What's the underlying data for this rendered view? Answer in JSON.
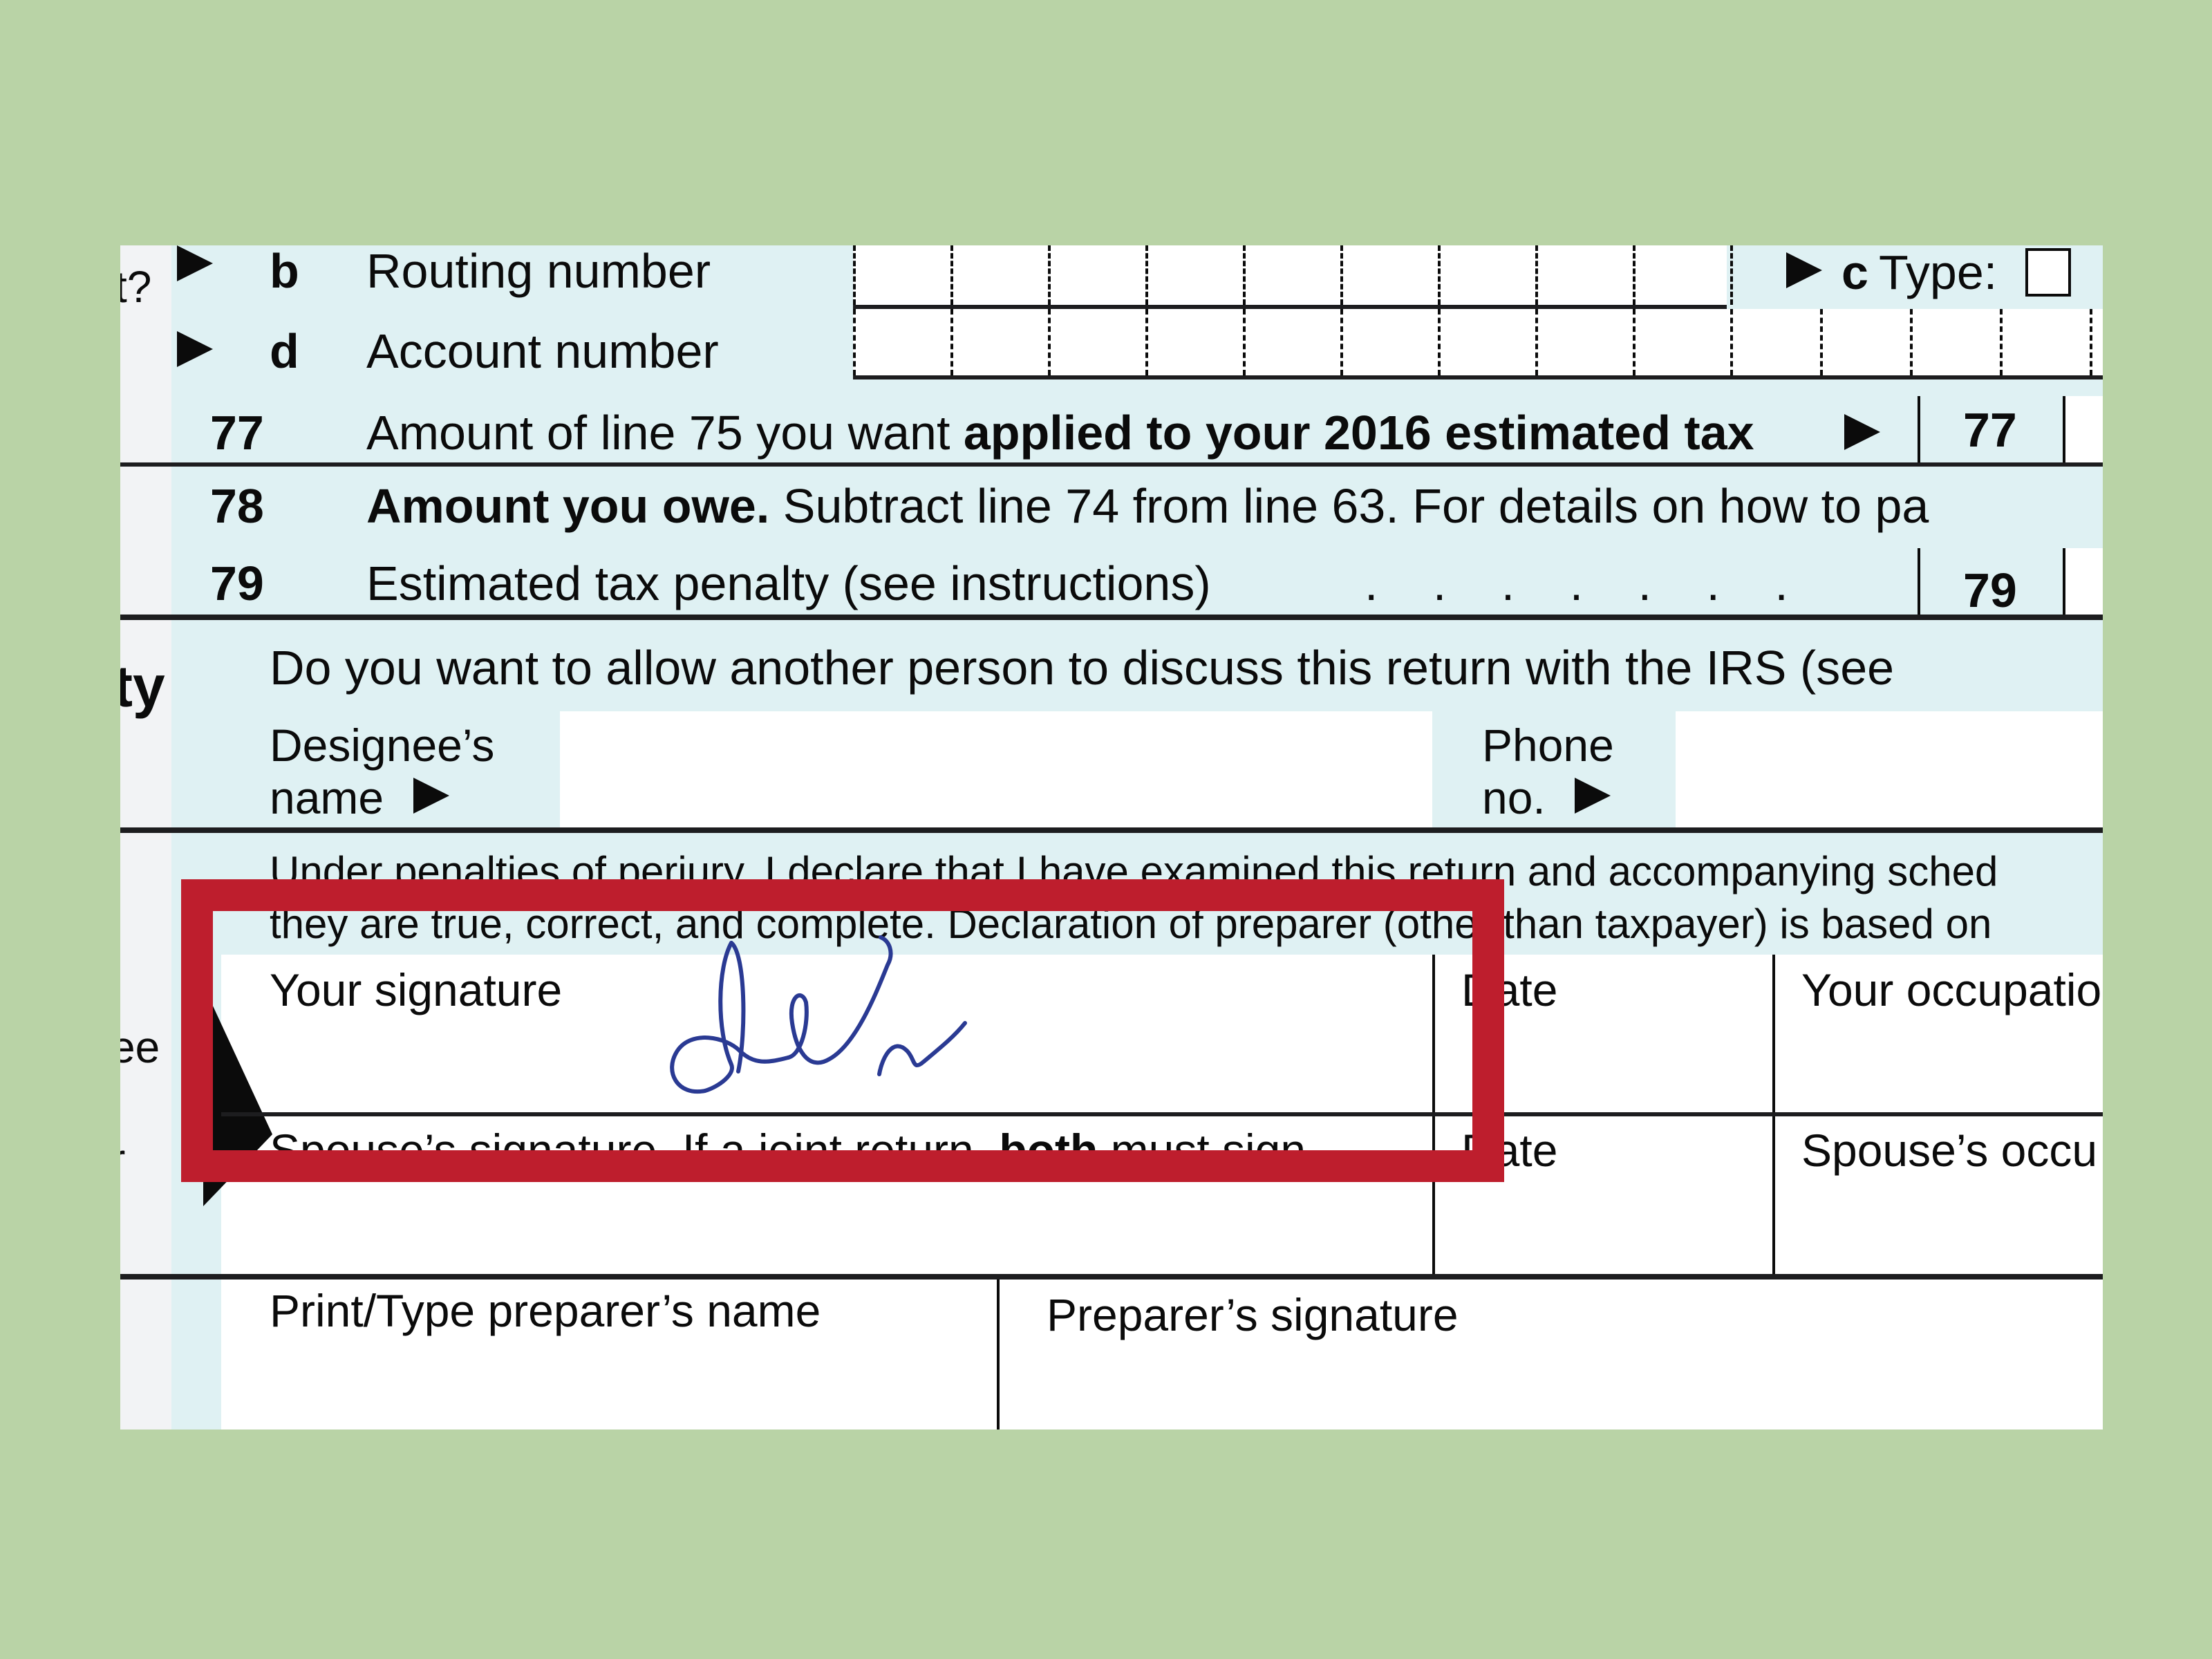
{
  "page": {
    "background_color": "#b9d3a6",
    "form_tint_color": "#dff1f3",
    "highlight_color": "#be1e2d",
    "signature_ink_color": "#2a3a93"
  },
  "gutter": {
    "top_label_fragment": "t?",
    "section_label_fragment": "ty",
    "sign_label_fragment_1": "ee",
    "sign_label_fragment_2": "r"
  },
  "direct_deposit": {
    "routing": {
      "letter": "b",
      "label": "Routing number",
      "cells": 9
    },
    "type": {
      "letter": "c",
      "label": "Type:"
    },
    "account": {
      "letter": "d",
      "label": "Account number",
      "cells": 13
    }
  },
  "lines": [
    {
      "number": "77",
      "text_plain": "Amount of line 75 you want ",
      "text_bold": "applied to your 2016 estimated tax",
      "box_label": "77",
      "value": ""
    },
    {
      "number": "78",
      "text_bold": "Amount you owe.",
      "text_plain": " Subtract line 74 from line 63. For details on how to pa"
    },
    {
      "number": "79",
      "text_plain": "Estimated tax penalty (see instructions)",
      "leader": ". . . . . . .",
      "box_label": "79",
      "value": ""
    }
  ],
  "third_party": {
    "question": "Do you want to allow another person to discuss this return with the IRS (see",
    "designee_label_1": "Designee’s",
    "designee_label_2": "name",
    "designee_value": "",
    "phone_label_1": "Phone",
    "phone_label_2": "no.",
    "phone_value": ""
  },
  "sign_here": {
    "declaration_line_1": "Under penalties of perjury, I declare that I have examined this return and accompanying sched",
    "declaration_line_2": "they are true, correct, and complete. Declaration of preparer (other than taxpayer) is based on",
    "your_signature_label": "Your signature",
    "your_signature_state": "signed",
    "date_label": "Date",
    "occupation_label": "Your occupatio",
    "spouse_signature_label_plain": "Spouse’s signature. If a joint return, ",
    "spouse_signature_label_bold": "both",
    "spouse_signature_label_end": " must sign.",
    "spouse_date_label": "Date",
    "spouse_occupation_label": "Spouse’s occu"
  },
  "preparer": {
    "name_label": "Print/Type preparer’s name",
    "signature_label": "Preparer’s signature"
  }
}
